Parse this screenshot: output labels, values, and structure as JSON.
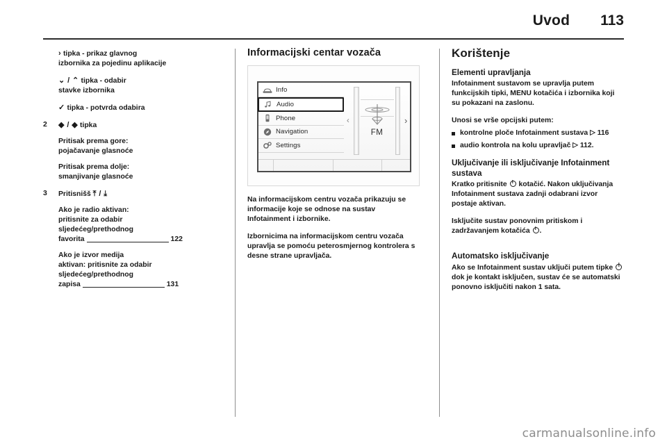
{
  "header": {
    "title": "Uvod",
    "page_number": "113"
  },
  "left_column": {
    "entries": [
      {
        "number": "",
        "glyph": "›",
        "lines": [
          "tipka - prikaz glavnog",
          "izbornika za pojedinu aplikacije"
        ]
      },
      {
        "number": "",
        "glyph": "⌄ / ⌃",
        "lines": [
          "tipka - odabir",
          "stavke izbornika"
        ]
      },
      {
        "number": "",
        "glyph": "✓",
        "lines": [
          "tipka - potvrda odabira"
        ]
      }
    ],
    "item2": {
      "number": "2",
      "glyph": "◆ / ◆",
      "heading": "tipka",
      "block1": [
        "Pritisak prema gore:",
        "pojačavanje glasnoće"
      ],
      "block2": [
        "Pritisak prema dolje:",
        "smanjivanje glasnoće"
      ]
    },
    "item3": {
      "number": "3",
      "heading": "Pritisnišš",
      "glyph": "⤒ / ⤓",
      "block1": {
        "lines": [
          "Ako je radio aktivan:",
          "pritisnite za odabir",
          "sljedećeg/prethodnog"
        ],
        "last_word": "favorita",
        "page": "122"
      },
      "block2": {
        "lines": [
          "Ako je izvor medija",
          "aktivan: pritisnite za odabir",
          "sljedećeg/prethodnog"
        ],
        "last_word": "zapisa",
        "page": "131"
      }
    }
  },
  "middle_column": {
    "heading": "Informacijski centar vozača",
    "figure": {
      "menu_items": [
        {
          "label": "Info",
          "icon": "car-icon",
          "selected": false
        },
        {
          "label": "Audio",
          "icon": "music-note-icon",
          "selected": true
        },
        {
          "label": "Phone",
          "icon": "phone-icon",
          "selected": false
        },
        {
          "label": "Navigation",
          "icon": "compass-icon",
          "selected": false
        },
        {
          "label": "Settings",
          "icon": "gears-icon",
          "selected": false
        }
      ],
      "band_label": "FM",
      "left_arrow": "‹",
      "right_arrow": "›"
    },
    "paragraphs": [
      "Na informacijskom centru vozača prikazuju se informacije koje se odnose na sustav Infotainment i izbornike.",
      "Izbornicima na informacijskom centru vozača upravlja se pomoću peterosmjernog kontrolera s desne strane upravljača."
    ]
  },
  "right_column": {
    "title": "Korištenje",
    "section1": {
      "heading": "Elementi upravljanja",
      "paragraph": "Infotainment sustavom se upravlja putem funkcijskih tipki, MENU kotačića i izbornika koji su pokazani na zaslonu.",
      "list_intro": "Unosi se vrše opcijski putem:",
      "bullets": [
        {
          "text": "kontrolne ploče Infotainment sustava",
          "ref_page": "116"
        },
        {
          "text": "audio kontrola na kolu upravljač",
          "ref_page": "112."
        }
      ]
    },
    "section2": {
      "heading": "Uključivanje ili isključivanje Infotainment sustava",
      "paragraph_a_pre": "Kratko pritisnite",
      "paragraph_a_post": "kotačić. Nakon uključivanja Infotainment sustava zadnji odabrani izvor postaje aktivan.",
      "paragraph_b_pre": "Isključite sustav ponovnim pritiskom i zadržavanjem kotačića",
      "paragraph_b_post": "."
    },
    "section3": {
      "heading": "Automatsko isključivanje",
      "paragraph_pre": "Ako se Infotainment sustav uključi putem tipke",
      "paragraph_post": "dok je kontakt isključen, sustav će se automatski ponovno isključiti nakon 1 sata."
    }
  },
  "footer": {
    "watermark": "carmanualsonline.info"
  }
}
